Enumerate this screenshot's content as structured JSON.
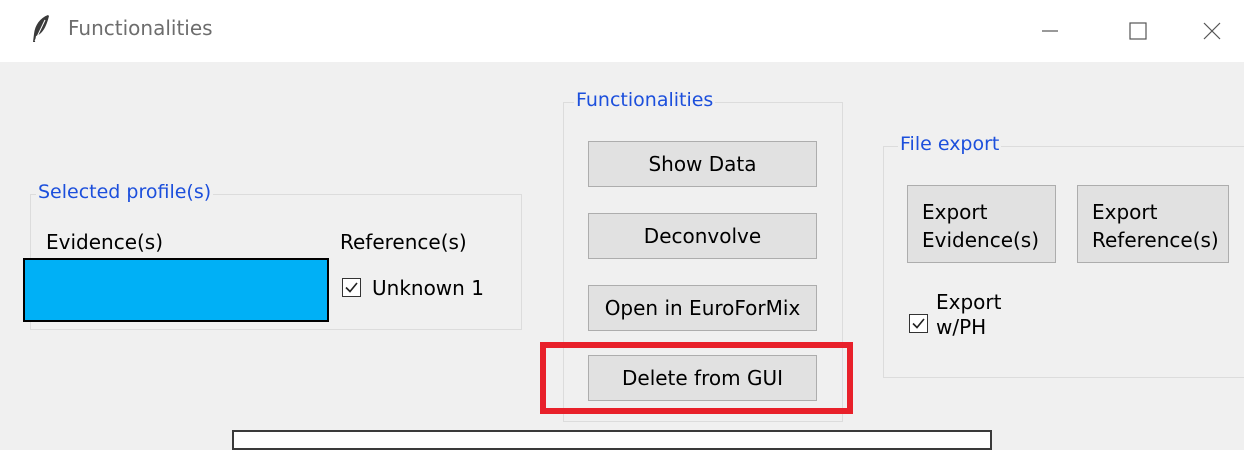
{
  "window": {
    "title": "Functionalities",
    "icon": "feather-icon"
  },
  "selected_profiles": {
    "title": "Selected profile(s)",
    "evidence_header": "Evidence(s)",
    "reference_header": "Reference(s)",
    "evidence_color": "#00b0f6",
    "references": [
      {
        "label": "Unknown 1",
        "checked": true
      }
    ]
  },
  "functionalities": {
    "title": "Functionalities",
    "buttons": {
      "show_data": "Show Data",
      "deconvolve": "Deconvolve",
      "open_euroformix": "Open in EuroForMix",
      "delete_gui": "Delete from GUI"
    },
    "highlight_color": "#e8202a"
  },
  "file_export": {
    "title": "File export",
    "export_evidence": "Export\nEvidence(s)",
    "export_reference": "Export\nReference(s)",
    "export_ph": {
      "label": "Export\nw/PH",
      "checked": true
    }
  },
  "icons": {
    "minimize": "minimize-icon",
    "maximize": "maximize-icon",
    "close": "close-icon",
    "checkmark": "checkmark-icon"
  }
}
